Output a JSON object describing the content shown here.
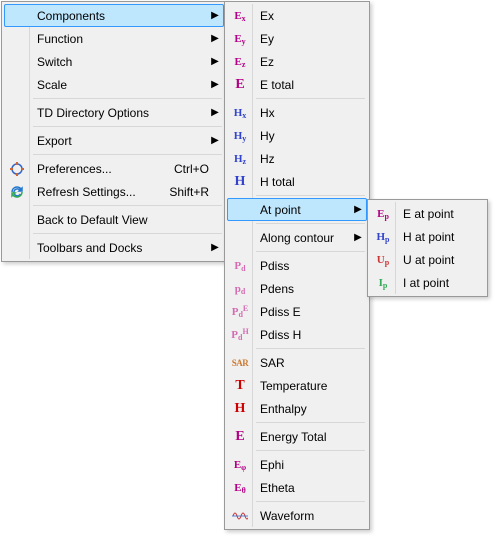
{
  "colors": {
    "highlight_bg": "#bee6fd",
    "highlight_border": "#3399ff",
    "e_color": "#b30086",
    "h_color": "#3344cc",
    "p_color": "#d36cb3",
    "sar_color": "#cc7a33",
    "t_color": "#cc0000",
    "enth_color": "#cc0000",
    "energy_color": "#b30086",
    "wave_color": "#3366cc"
  },
  "menu1": {
    "components": {
      "label": "Components"
    },
    "function": {
      "label": "Function"
    },
    "switch": {
      "label": "Switch"
    },
    "scale": {
      "label": "Scale"
    },
    "td_options": {
      "label": "TD Directory Options"
    },
    "export": {
      "label": "Export"
    },
    "preferences": {
      "label": "Preferences...",
      "shortcut": "Ctrl+O"
    },
    "refresh": {
      "label": "Refresh Settings...",
      "shortcut": "Shift+R"
    },
    "back_default": {
      "label": "Back to Default View"
    },
    "toolbars": {
      "label": "Toolbars and Docks"
    }
  },
  "menu2": {
    "ex": "Ex",
    "ey": "Ey",
    "ez": "Ez",
    "etotal": "E total",
    "hx": "Hx",
    "hy": "Hy",
    "hz": "Hz",
    "htotal": "H total",
    "at_point": "At point",
    "along_contour": "Along contour",
    "pdiss": "Pdiss",
    "pdens": "Pdens",
    "pdisse": "Pdiss E",
    "pdissh": "Pdiss H",
    "sar": "SAR",
    "temperature": "Temperature",
    "enthalpy": "Enthalpy",
    "energy_total": "Energy Total",
    "ephi": "Ephi",
    "etheta": "Etheta",
    "waveform": "Waveform"
  },
  "menu3": {
    "e": "E at point",
    "h": "H at point",
    "u": "U at point",
    "i": "I at point"
  }
}
